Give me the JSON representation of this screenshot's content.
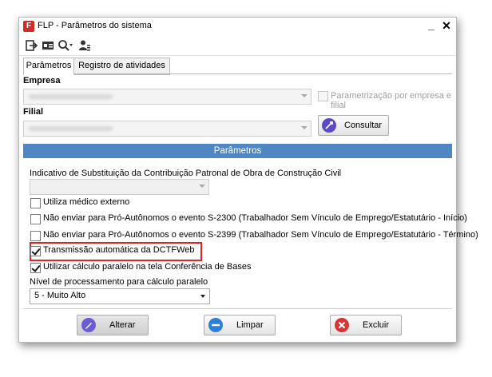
{
  "window": {
    "title": "FLP - Parâmetros do sistema",
    "app_icon_letter": "F",
    "minimize_glyph": "_",
    "close_glyph": "✕"
  },
  "toolbar": {
    "icons": [
      "exit-icon",
      "card-icon",
      "search-icon",
      "user-icon"
    ]
  },
  "tabs": [
    {
      "label": "Parâmetros",
      "active": true
    },
    {
      "label": "Registro de atividades",
      "active": false
    }
  ],
  "empresa": {
    "label": "Empresa",
    "per_company_checkbox_label": "Parametrização por empresa e filial",
    "per_company_checked": false
  },
  "filial": {
    "label": "Filial",
    "consult_button": "Consultar"
  },
  "section_header": "Parâmetros",
  "params": {
    "substitution_label": "Indicativo de Substituição da Contribuição Patronal de Obra de Construção Civil",
    "checkboxes": [
      {
        "label": "Utiliza médico externo",
        "checked": false
      },
      {
        "label": "Não enviar para Pró-Autônomos o evento S-2300 (Trabalhador Sem Vínculo de Emprego/Estatutário - Início)",
        "checked": false
      },
      {
        "label": "Não enviar para Pró-Autônomos o evento S-2399 (Trabalhador Sem Vínculo de Emprego/Estatutário - Término)",
        "checked": false
      },
      {
        "label": "Transmissão automática da DCTFWeb",
        "checked": true
      },
      {
        "label": "Utilizar cálculo paralelo na tela Conferência de Bases",
        "checked": true
      }
    ],
    "processing_level_label": "Nível de processamento para cálculo paralelo",
    "processing_level_value": "5 - Muito Alto"
  },
  "footer": {
    "alterar": "Alterar",
    "limpar": "Limpar",
    "excluir": "Excluir"
  },
  "colors": {
    "header_band": "#4f87c2",
    "highlight": "#e02424",
    "app_icon": "#d22b2b"
  }
}
